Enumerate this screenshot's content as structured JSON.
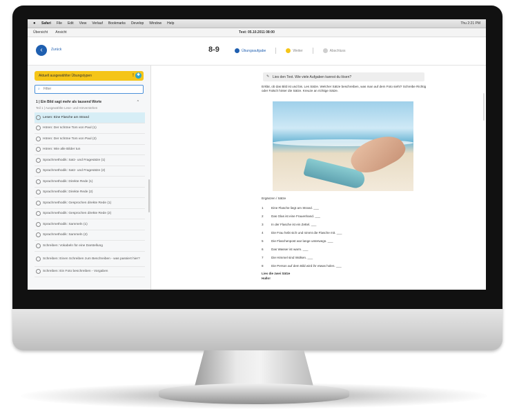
{
  "menubar": {
    "app": "Safari",
    "items": [
      "File",
      "Edit",
      "View",
      "Verlauf",
      "Bookmarks",
      "Develop",
      "Window",
      "Help"
    ],
    "right": "Thu 2:21 PM"
  },
  "browser": {
    "left_items": [
      "Übersicht",
      "Ansicht"
    ],
    "title": "Test: 05.10.2011 08:00"
  },
  "toolbar": {
    "back_label": "Zurück",
    "page_range": "8-9",
    "steps": [
      {
        "label": "Übungsaufgabe",
        "state": "active"
      },
      {
        "label": "Weiter",
        "state": "next"
      },
      {
        "label": "Abschluss",
        "state": "off"
      }
    ]
  },
  "sidebar": {
    "filter_label": "Aktuell ausgewählter Übungstypen",
    "search_placeholder": "Filter",
    "section_title": "1 | Ein Bild sagt mehr als tausend Worte",
    "section_subtitle": "Teil 1 | Ausgewählte Lese- und Hörverstehen",
    "lessons": [
      "Lesen: Eine Flasche am Strand",
      "Hören: Der schöne Tom von Paul (1)",
      "Hören: Der schöne Tom von Paul (2)",
      "Hören: Wie alle Bilder tun",
      "Sprachmethodik: Satz- und Fragesätze (1)",
      "Sprachmethodik: Satz- und Fragesätze (2)",
      "Sprachmethodik: Direkte Rede (1)",
      "Sprachmethodik: Direkte Rede (2)",
      "Sprachmethodik: Gesprochen direkte Rede (1)",
      "Sprachmethodik: Gesprochen direkte Rede (2)",
      "Sprachmethodik: Sammeln (1)",
      "Sprachmethodik: Sammeln (2)",
      "Schreiben: Vokabeln für eine Darstellung",
      "Schreiben: Einen Schreiben zum Beschreiben - was passiert hier?",
      "Schreiben: Ein Foto beschreiben - Vorgaben"
    ]
  },
  "content": {
    "task_prompt": "Lies den Text. Wie viele Aufgaben kannst du lösen?",
    "intro": "Erklär, ob das Bild ist und bis. Les Sätze. Welcher Sätze beschreiben, was man auf dem Foto sieht? Schreibe Richtig oder Falsch hinter die Sätze. Kreuze an richtige Sätze.",
    "sentences_header": "Ergänzen / Sätze",
    "sentences": [
      {
        "n": "1",
        "text": "Eine Flasche liegt am Strand. ___"
      },
      {
        "n": "2",
        "text": "Das Glas ist eine Frauenhand. ___"
      },
      {
        "n": "3",
        "text": "In der Flasche ist ein Zettel. ___"
      },
      {
        "n": "4",
        "text": "Die Frau hebt sich und nimmt die Flasche mit. ___"
      },
      {
        "n": "5",
        "text": "Die Flaschenpost war lange unterwegs. ___"
      },
      {
        "n": "6",
        "text": "Das Wasser ist warm. ___"
      },
      {
        "n": "7",
        "text": "Die Himmel sind Wolken. ___"
      },
      {
        "n": "8",
        "text": "Die Person auf dem Bild wird ihr etwas holen. ___"
      }
    ],
    "tail": "Lies die zwei Sätze",
    "tail2": "Hallo!"
  }
}
